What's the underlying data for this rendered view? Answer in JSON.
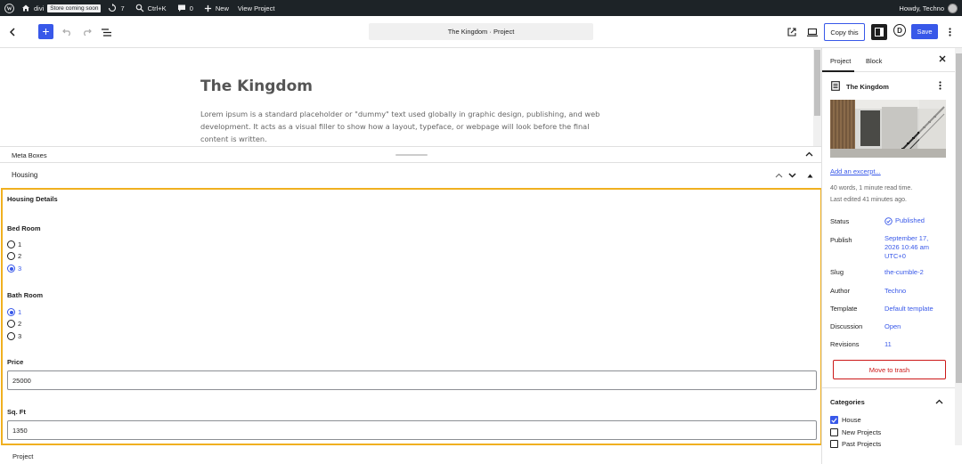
{
  "admin_bar": {
    "site_name": "divi",
    "store_badge": "Store coming soon",
    "updates_count": "7",
    "search_shortcut": "Ctrl+K",
    "comments_count": "0",
    "new_label": "New",
    "view_label": "View Project",
    "greeting": "Howdy, Techno",
    "icons": [
      "wordpress-logo-icon",
      "home-icon",
      "updates-icon",
      "search-icon",
      "comment-icon",
      "plus-icon",
      "avatar"
    ]
  },
  "header": {
    "document_title": "The Kingdom · Project",
    "copy_label": "Copy this",
    "save_label": "Save",
    "accent_color": "#3858e9",
    "icons": [
      "back-chevron-icon",
      "add-block-icon",
      "undo-icon",
      "redo-icon",
      "document-overview-icon",
      "external-link-icon",
      "device-preview-icon",
      "settings-toggle-icon",
      "divi-logo-icon",
      "more-options-icon"
    ]
  },
  "canvas": {
    "title": "The Kingdom",
    "content": "Lorem ipsum is a standard placeholder or \"dummy\" text used globally in graphic design, publishing, and web development. It acts as a visual filler to show how a layout, typeface, or webpage will look before the final content is written."
  },
  "meta_boxes": {
    "header_label": "Meta Boxes",
    "housing_label": "Housing",
    "details_title": "Housing Details",
    "bed_room": {
      "label": "Bed Room",
      "options": [
        "1",
        "2",
        "3"
      ],
      "selected": "3"
    },
    "bath_room": {
      "label": "Bath Room",
      "options": [
        "1",
        "2",
        "3"
      ],
      "selected": "1"
    },
    "price": {
      "label": "Price",
      "value": "25000"
    },
    "sqft": {
      "label": "Sq. Ft",
      "value": "1350"
    },
    "highlight_color": "#f0b020"
  },
  "footer": {
    "breadcrumb": "Project"
  },
  "sidebar": {
    "tabs": [
      "Project",
      "Block"
    ],
    "active_tab": "Project",
    "post_title": "The Kingdom",
    "excerpt_link": "Add an excerpt...",
    "word_count": "40 words, 1 minute read time.",
    "last_edited": "Last edited 41 minutes ago.",
    "rows": {
      "status": {
        "label": "Status",
        "value": "Published"
      },
      "publish": {
        "label": "Publish",
        "value_lines": [
          "September 17,",
          "2026 10:46 am",
          "UTC+0"
        ]
      },
      "slug": {
        "label": "Slug",
        "value": "the-cumble-2"
      },
      "author": {
        "label": "Author",
        "value": "Techno"
      },
      "template": {
        "label": "Template",
        "value": "Default template"
      },
      "discussion": {
        "label": "Discussion",
        "value": "Open"
      },
      "revisions": {
        "label": "Revisions",
        "value": "11"
      }
    },
    "trash_label": "Move to trash",
    "categories": {
      "title": "Categories",
      "items": [
        {
          "label": "House",
          "checked": true
        },
        {
          "label": "New Projects",
          "checked": false
        },
        {
          "label": "Past Projects",
          "checked": false
        }
      ]
    }
  }
}
